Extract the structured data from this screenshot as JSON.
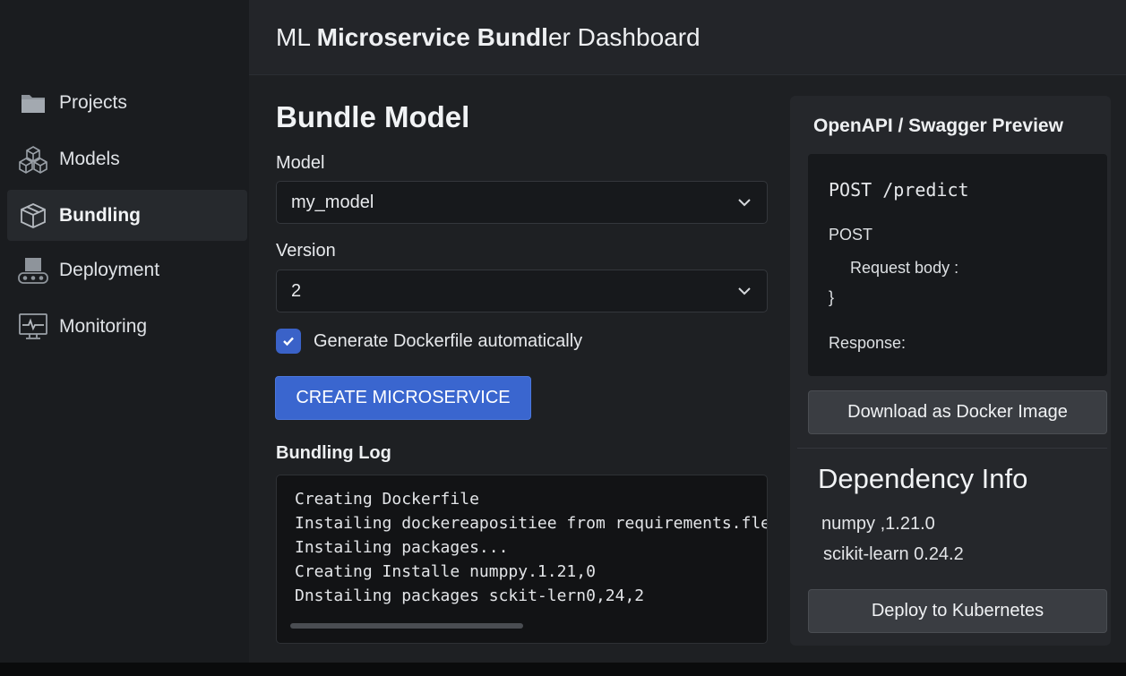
{
  "header": {
    "title_prefix": "ML ",
    "title_bold": "Microservice Bundl",
    "title_suffix": "er Dashboard"
  },
  "sidebar": {
    "items": [
      {
        "label": "Projects",
        "icon": "folder-icon"
      },
      {
        "label": "Models",
        "icon": "cubes-icon"
      },
      {
        "label": "Bundling",
        "icon": "package-icon",
        "active": true
      },
      {
        "label": "Deployment",
        "icon": "conveyor-icon"
      },
      {
        "label": "Monitoring",
        "icon": "monitor-icon"
      }
    ]
  },
  "form": {
    "title": "Bundle Model",
    "model_label": "Model",
    "model_value": "my_model",
    "version_label": "Version",
    "version_value": "2",
    "dockerfile_checkbox_label": "Generate Dockerfile automatically",
    "dockerfile_checked": true,
    "create_button": "CREATE MICROSERVICE"
  },
  "log": {
    "title": "Bundling Log",
    "lines": [
      "Creating Dockerfile",
      "Instailing dockereapositiee from requirements.fle",
      "Instailing packages...",
      "Creating Installe numppy.1.21,0",
      "Dnstailing packages sckit-lern0,24,2"
    ]
  },
  "swagger": {
    "title": "OpenAPI / Swagger Preview",
    "endpoint": "POST /predict",
    "method": "POST",
    "request_body": "Request body :",
    "brace": "}",
    "response": "Response:",
    "download_button": "Download as Docker Image"
  },
  "dependencies": {
    "title": "Dependency Info",
    "items": [
      {
        "text": "numpy ,1.21.0"
      },
      {
        "text": "scikit-learn  0.24.2"
      }
    ],
    "deploy_button": "Deploy to Kubernetes"
  },
  "colors": {
    "accent": "#3a66cf",
    "sidebar_bg": "#1a1c1f",
    "main_bg": "#1e2023"
  }
}
